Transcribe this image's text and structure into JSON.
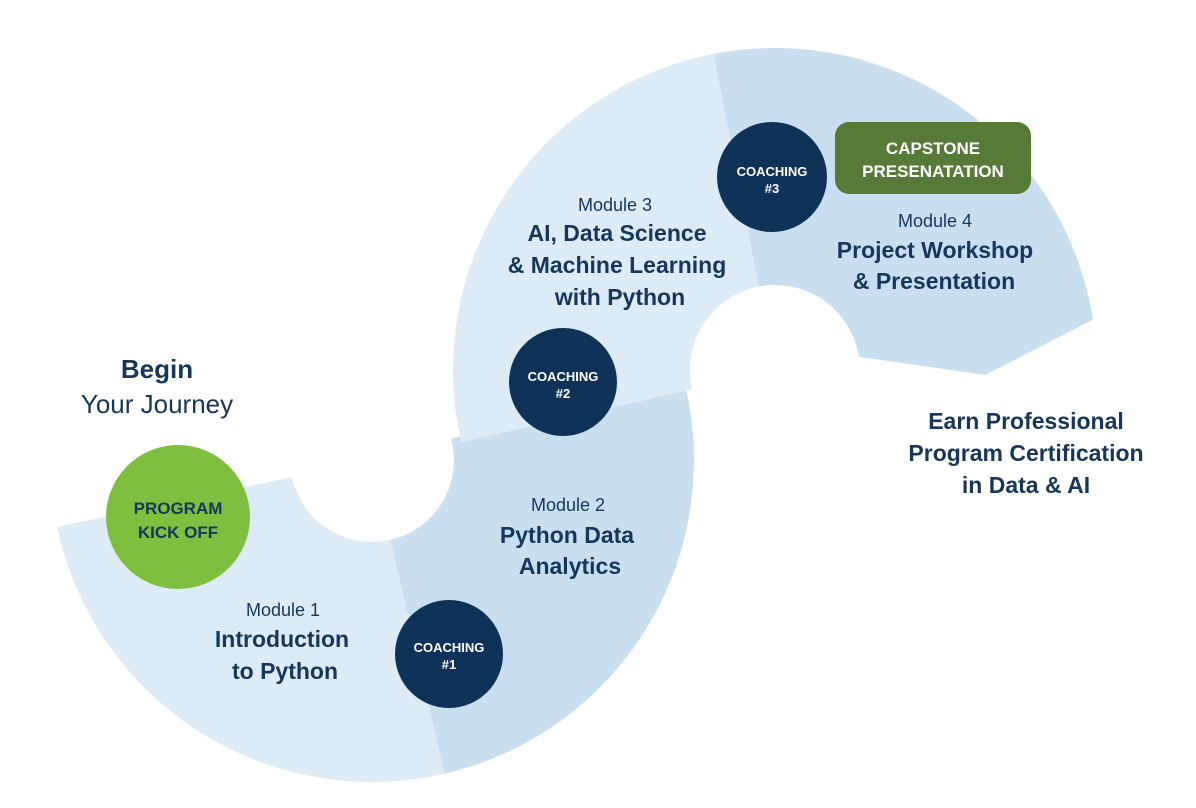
{
  "colors": {
    "segment_light": "#ddebf6",
    "segment_dark": "#c9dff0",
    "coaching_navy": "#0f3358",
    "kickoff_green": "#7fbf3f",
    "capstone_green": "#577a37",
    "text_navy": "#16365c"
  },
  "start": {
    "line1": "Begin",
    "line2": "Your Journey"
  },
  "kickoff": {
    "line1": "PROGRAM",
    "line2": "KICK OFF"
  },
  "modules": [
    {
      "label": "Module 1",
      "title": [
        "Introduction",
        "to Python"
      ]
    },
    {
      "label": "Module 2",
      "title": [
        "Python Data",
        "Analytics"
      ]
    },
    {
      "label": "Module 3",
      "title": [
        "AI, Data Science",
        "& Machine Learning",
        "with Python"
      ]
    },
    {
      "label": "Module 4",
      "title": [
        "Project Workshop",
        "& Presentation"
      ]
    }
  ],
  "coaching": [
    {
      "line1": "COACHING",
      "line2": "#1"
    },
    {
      "line1": "COACHING",
      "line2": "#2"
    },
    {
      "line1": "COACHING",
      "line2": "#3"
    }
  ],
  "capstone": {
    "line1": "CAPSTONE",
    "line2": "PRESENATATION"
  },
  "finish": {
    "lines": [
      "Earn Professional",
      "Program Certification",
      "in Data & AI"
    ]
  }
}
